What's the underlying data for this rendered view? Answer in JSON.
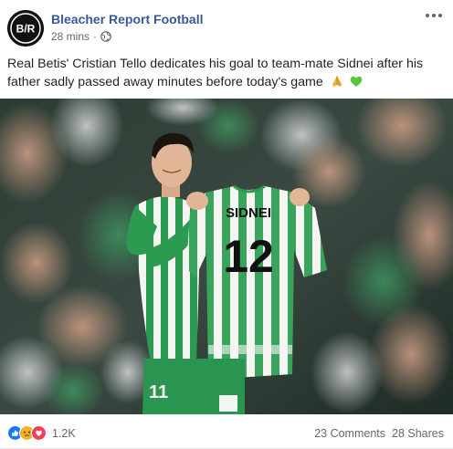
{
  "post": {
    "page_name": "Bleacher Report Football",
    "avatar_letters": "B/R",
    "timestamp": "28 mins",
    "separator": "·",
    "privacy_icon": "globe-icon",
    "more_icon": "more-options-icon",
    "text": "Real Betis' Cristian Tello dedicates his goal to team-mate Sidnei after his father sadly passed away minutes before today's game",
    "text_emojis": [
      "folded-hands",
      "green-heart"
    ]
  },
  "photo": {
    "shirt_name": "SIDNEI",
    "shirt_number": "12",
    "shorts_number": "11"
  },
  "footer": {
    "reaction_icons": [
      "like-icon",
      "sad-icon",
      "love-icon"
    ],
    "reaction_count": "1.2K",
    "comments": "23 Comments",
    "shares": "28 Shares"
  },
  "colors": {
    "page_name": "#385898",
    "meta": "#616770",
    "betis_green": "#2e9f55",
    "like_blue": "#1877f2",
    "love_red": "#f33e58",
    "sad_yellow": "#f7b125"
  }
}
